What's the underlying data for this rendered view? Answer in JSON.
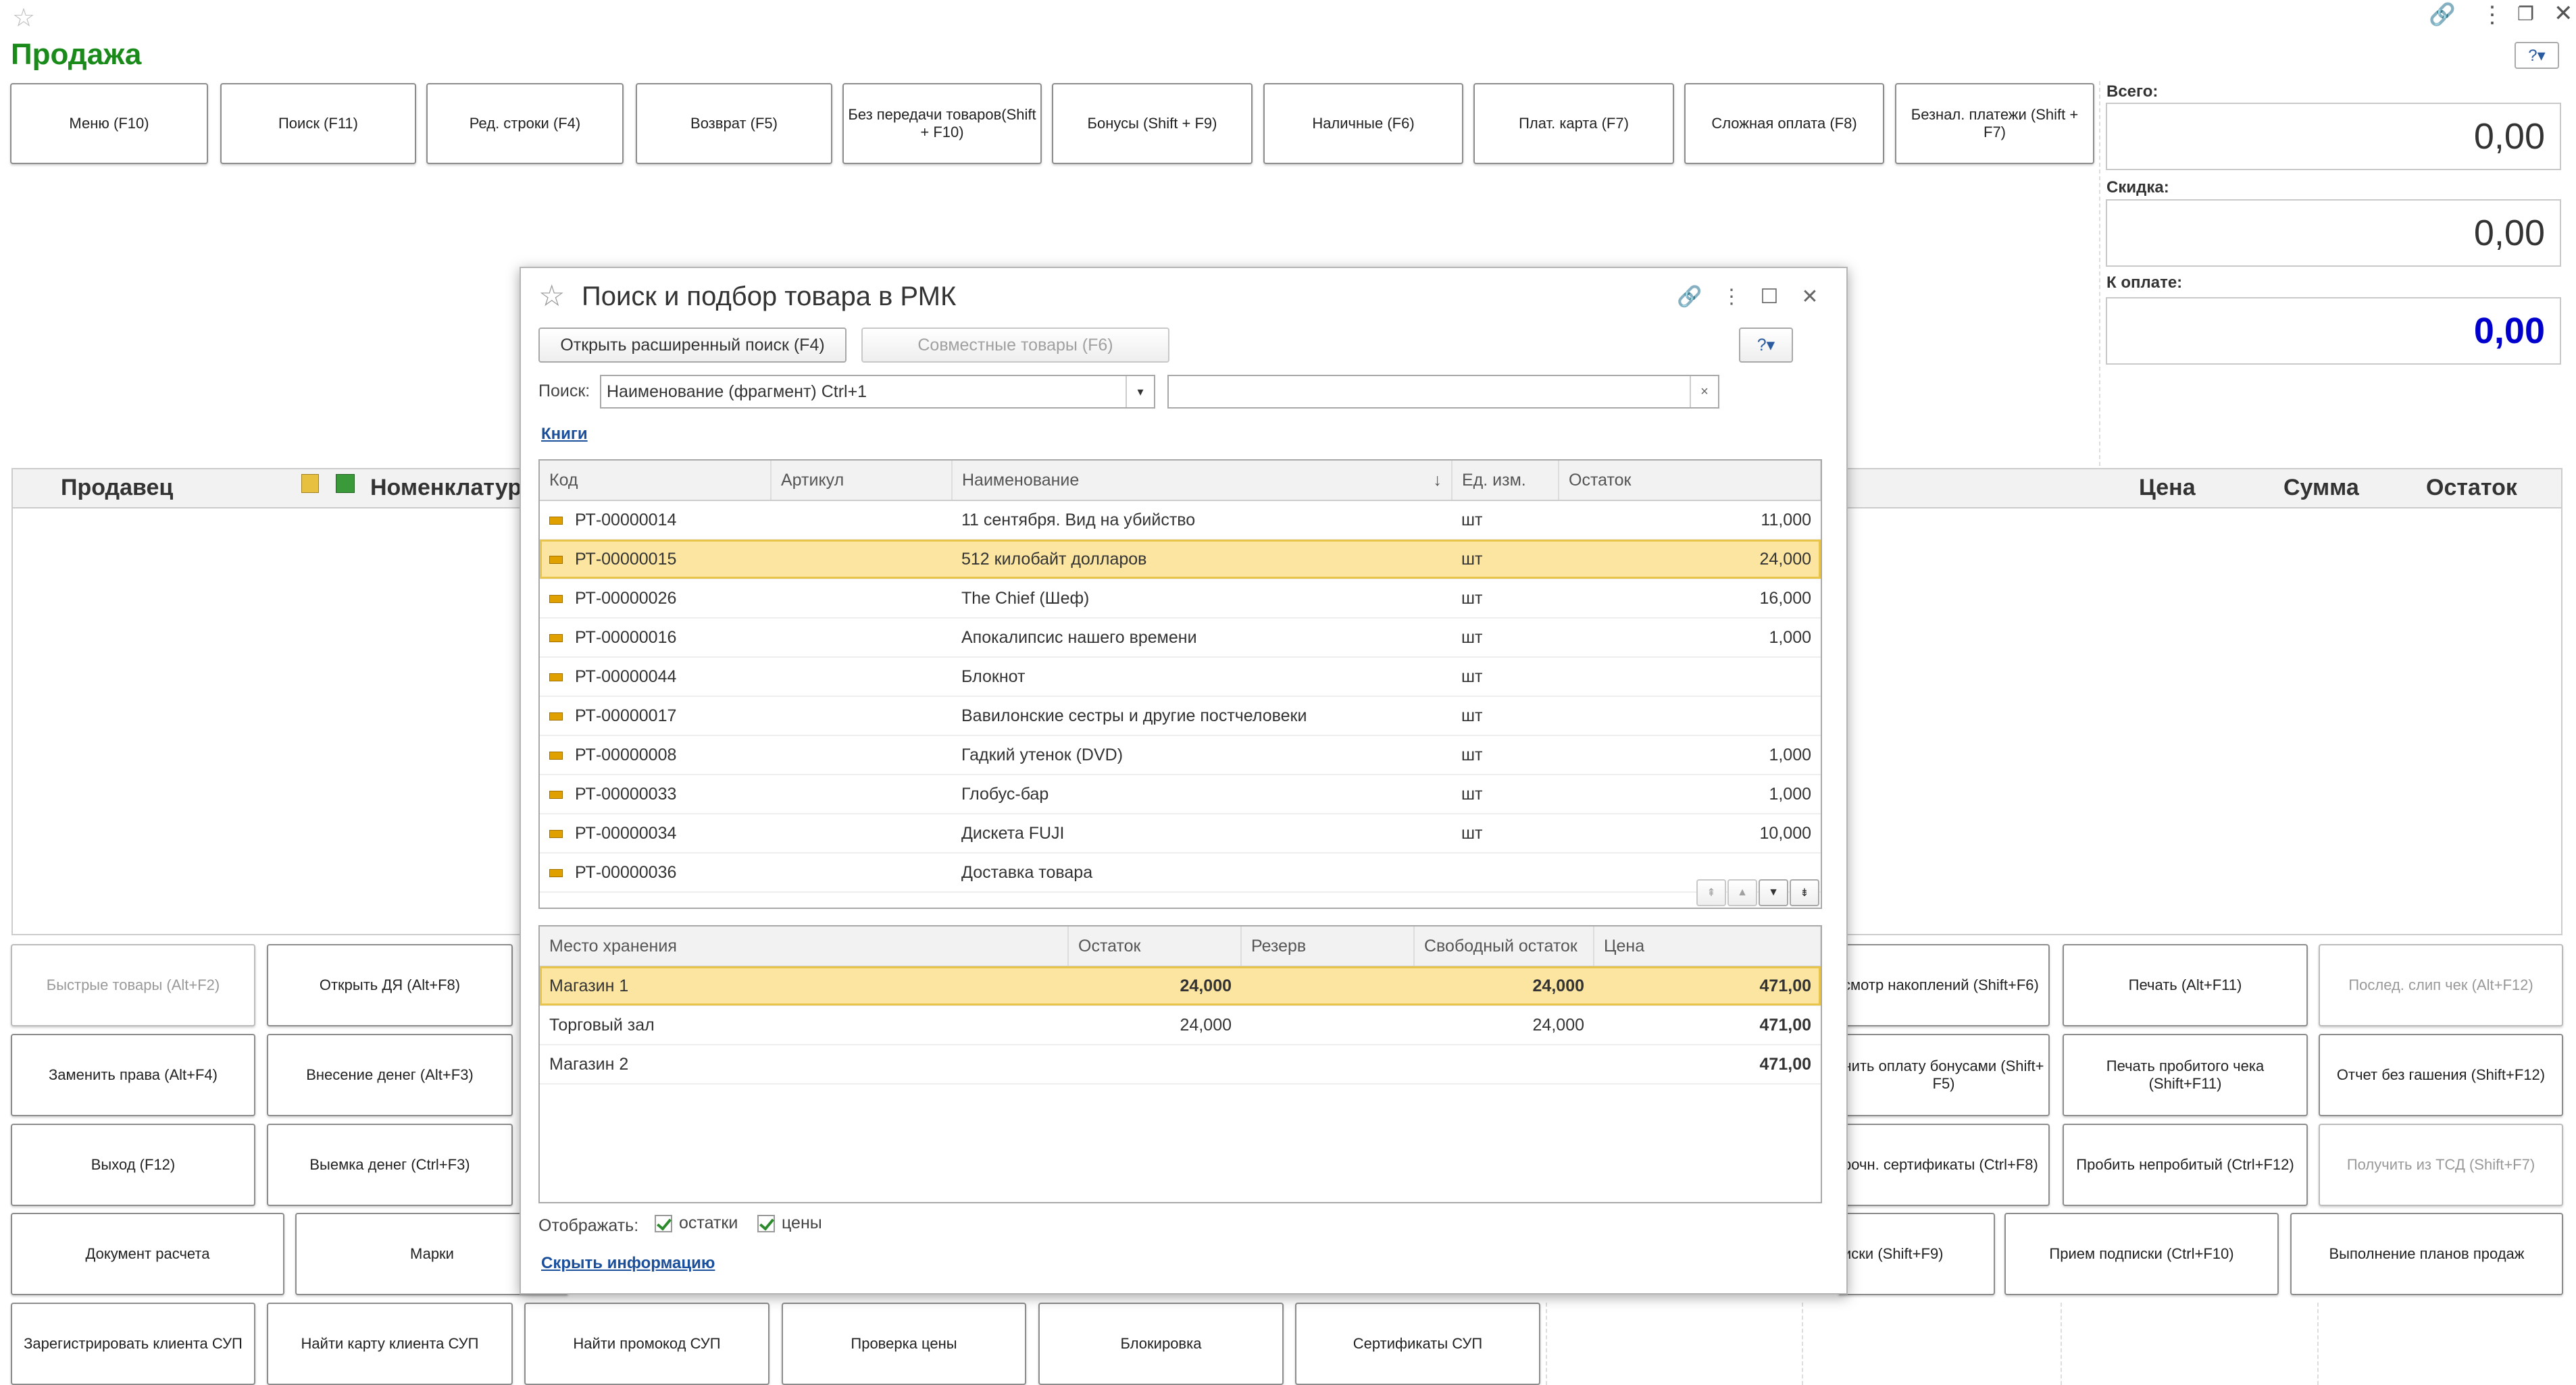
{
  "window": {
    "title": "Продажа"
  },
  "toolbar": {
    "buttons": [
      "Меню (F10)",
      "Поиск (F11)",
      "Ред. строки (F4)",
      "Возврат (F5)",
      "Без передачи товаров(Shift + F10)",
      "Бонусы (Shift + F9)",
      "Наличные (F6)",
      "Плат. карта (F7)",
      "Сложная оплата (F8)",
      "Безнал. платежи (Shift + F7)"
    ]
  },
  "totals": {
    "total_label": "Всего:",
    "total_value": "0,00",
    "discount_label": "Скидка:",
    "discount_value": "0,00",
    "topay_label": "К оплате:",
    "topay_value": "0,00",
    "topay_color": "#0000cc"
  },
  "main_table": {
    "col_seller": "Продавец",
    "col_nomen": "Номенклатур",
    "col_price": "Цена",
    "col_sum": "Сумма",
    "col_rest": "Остаток"
  },
  "bottom_buttons": {
    "r1": [
      "Быстрые товары (Alt+F2)",
      "Открыть ДЯ (Alt+F8)",
      "смотр накоплений (Shift+F6)",
      "Печать (Alt+F11)",
      "Послед. слип чек (Alt+F12)"
    ],
    "r2": [
      "Заменить права (Alt+F4)",
      "Внесение денег (Alt+F3)",
      "нить оплату бонусами (Shift+ F5)",
      "Печать пробитого чека (Shift+F11)",
      "Отчет без гашения (Shift+F12)"
    ],
    "r3": [
      "Выход (F12)",
      "Выемка денег (Ctrl+F3)",
      "рочн. сертификаты (Ctrl+F8)",
      "Пробить непробитый (Ctrl+F12)",
      "Получить из ТСД (Shift+F7)"
    ],
    "r4": [
      "Документ расчета",
      "Марки",
      "иски (Shift+F9)",
      "Прием подписки (Ctrl+F10)",
      "Выполнение планов продаж"
    ],
    "r5": [
      "Зарегистрировать клиента СУП",
      "Найти карту клиента СУП",
      "Найти промокод СУП",
      "Проверка цены",
      "Блокировка",
      "Сертификаты СУП"
    ]
  },
  "modal": {
    "title": "Поиск и подбор товара в РМК",
    "btn_extended": "Открыть расширенный поиск (F4)",
    "btn_joint": "Совместные товары (F6)",
    "search_label": "Поиск:",
    "search_mode": "Наименование (фрагмент) Ctrl+1",
    "search_value": "",
    "group_link": "Книги",
    "columns": [
      "Код",
      "Артикул",
      "Наименование",
      "Ед. изм.",
      "Остаток"
    ],
    "rows": [
      {
        "code": "РТ-00000014",
        "art": "",
        "name": "11 сентября. Вид на убийство",
        "unit": "шт",
        "rest": "11,000"
      },
      {
        "code": "РТ-00000015",
        "art": "",
        "name": "512 килобайт долларов",
        "unit": "шт",
        "rest": "24,000"
      },
      {
        "code": "РТ-00000026",
        "art": "",
        "name": "The Chief (Шеф)",
        "unit": "шт",
        "rest": "16,000"
      },
      {
        "code": "РТ-00000016",
        "art": "",
        "name": "Апокалипсис нашего времени",
        "unit": "шт",
        "rest": "1,000"
      },
      {
        "code": "РТ-00000044",
        "art": "",
        "name": "Блокнот",
        "unit": "шт",
        "rest": ""
      },
      {
        "code": "РТ-00000017",
        "art": "",
        "name": "Вавилонские сестры и другие постчеловеки",
        "unit": "шт",
        "rest": ""
      },
      {
        "code": "РТ-00000008",
        "art": "",
        "name": "Гадкий утенок (DVD)",
        "unit": "шт",
        "rest": "1,000"
      },
      {
        "code": "РТ-00000033",
        "art": "",
        "name": "Глобус-бар",
        "unit": "шт",
        "rest": "1,000"
      },
      {
        "code": "РТ-00000034",
        "art": "",
        "name": "Дискета FUJI",
        "unit": "шт",
        "rest": "10,000"
      },
      {
        "code": "РТ-00000036",
        "art": "",
        "name": "Доставка товара",
        "unit": "",
        "rest": ""
      }
    ],
    "stock_columns": [
      "Место хранения",
      "Остаток",
      "Резерв",
      "Свободный остаток",
      "Цена"
    ],
    "stock_rows": [
      {
        "place": "Магазин 1",
        "rest": "24,000",
        "reserve": "",
        "free": "24,000",
        "price": "471,00"
      },
      {
        "place": "Торговый зал",
        "rest": "24,000",
        "reserve": "",
        "free": "24,000",
        "price": "471,00"
      },
      {
        "place": "Магазин 2",
        "rest": "",
        "reserve": "",
        "free": "",
        "price": "471,00"
      }
    ],
    "show_label": "Отображать:",
    "cb_rest": "остатки",
    "cb_price": "цены",
    "hide_link": "Скрыть информацию"
  }
}
